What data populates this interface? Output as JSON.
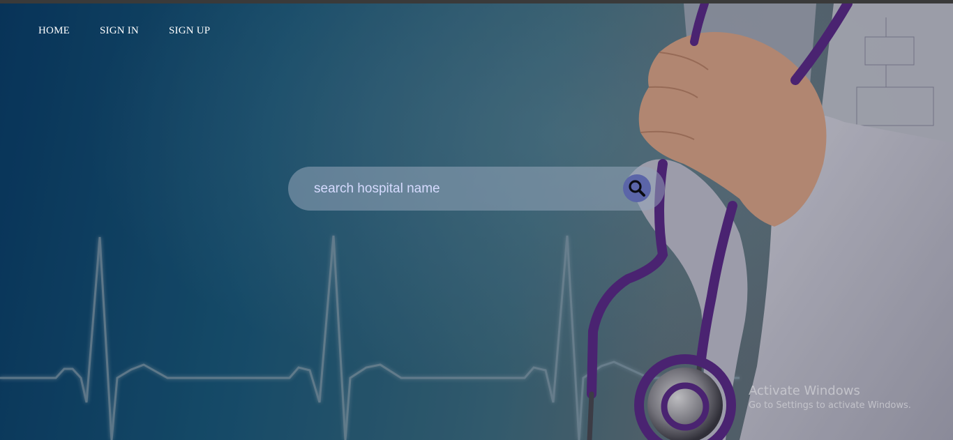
{
  "nav": {
    "home_label": "HOME",
    "signin_label": "SIGN IN",
    "signup_label": "SIGN UP"
  },
  "search": {
    "placeholder": "search hospital name",
    "button_icon": "search-icon"
  },
  "watermark": {
    "title": "Activate Windows",
    "subtitle": "Go to Settings to activate Windows."
  },
  "colors": {
    "search_button": "#5b65a8",
    "stethoscope": "#5b2b8a",
    "ekg_line": "#8aa3b4"
  }
}
